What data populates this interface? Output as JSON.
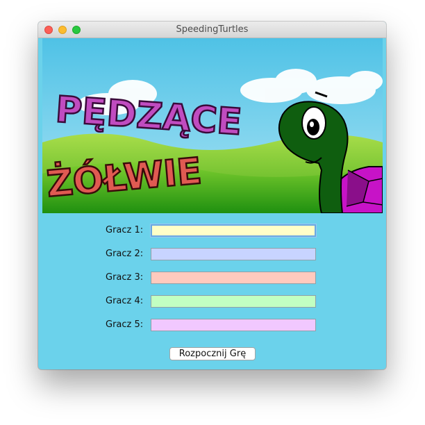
{
  "window": {
    "title": "SpeedingTurtles"
  },
  "banner": {
    "line1": "PĘDZĄCE",
    "line2": "ŻÓŁWIE"
  },
  "players": [
    {
      "label": "Gracz 1:",
      "value": "",
      "color": "#ffffc8"
    },
    {
      "label": "Gracz 2:",
      "value": "",
      "color": "#c8d4ff"
    },
    {
      "label": "Gracz 3:",
      "value": "",
      "color": "#ffcabe"
    },
    {
      "label": "Gracz 4:",
      "value": "",
      "color": "#c2ffc2"
    },
    {
      "label": "Gracz 5:",
      "value": "",
      "color": "#f1c8ff"
    }
  ],
  "start_button": {
    "label": "Rozpocznij Grę"
  },
  "colors": {
    "background": "#6bd2eb",
    "title_magenta": "#c04cc0",
    "title_red": "#e05a52"
  }
}
